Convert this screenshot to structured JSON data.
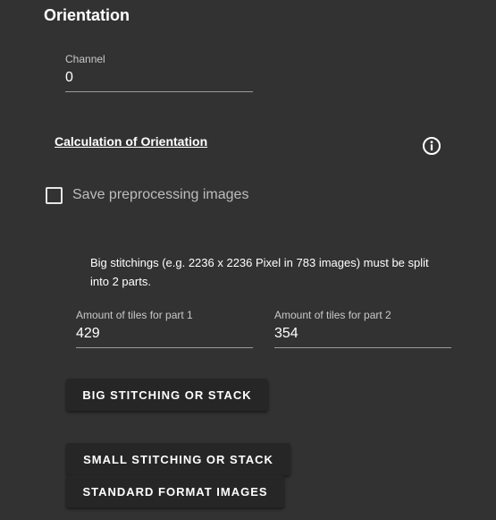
{
  "section": {
    "title": "Orientation"
  },
  "channel": {
    "label": "Channel",
    "value": "0"
  },
  "calculation": {
    "heading": "Calculation of Orientation",
    "info_icon": "info-circle-icon"
  },
  "preprocessing": {
    "label": "Save preprocessing images",
    "checked": false
  },
  "big_stitching": {
    "message": "Big stitchings (e.g. 2236 x 2236 Pixel in 783 images) must be split into 2 parts.",
    "part1": {
      "label": "Amount of tiles for part 1",
      "value": "429"
    },
    "part2": {
      "label": "Amount of tiles for part 2",
      "value": "354"
    }
  },
  "buttons": {
    "big_stitching": "BIG STITCHING OR STACK",
    "small_stitching": "SMALL STITCHING OR STACK",
    "standard_format": "STANDARD FORMAT IMAGES"
  }
}
